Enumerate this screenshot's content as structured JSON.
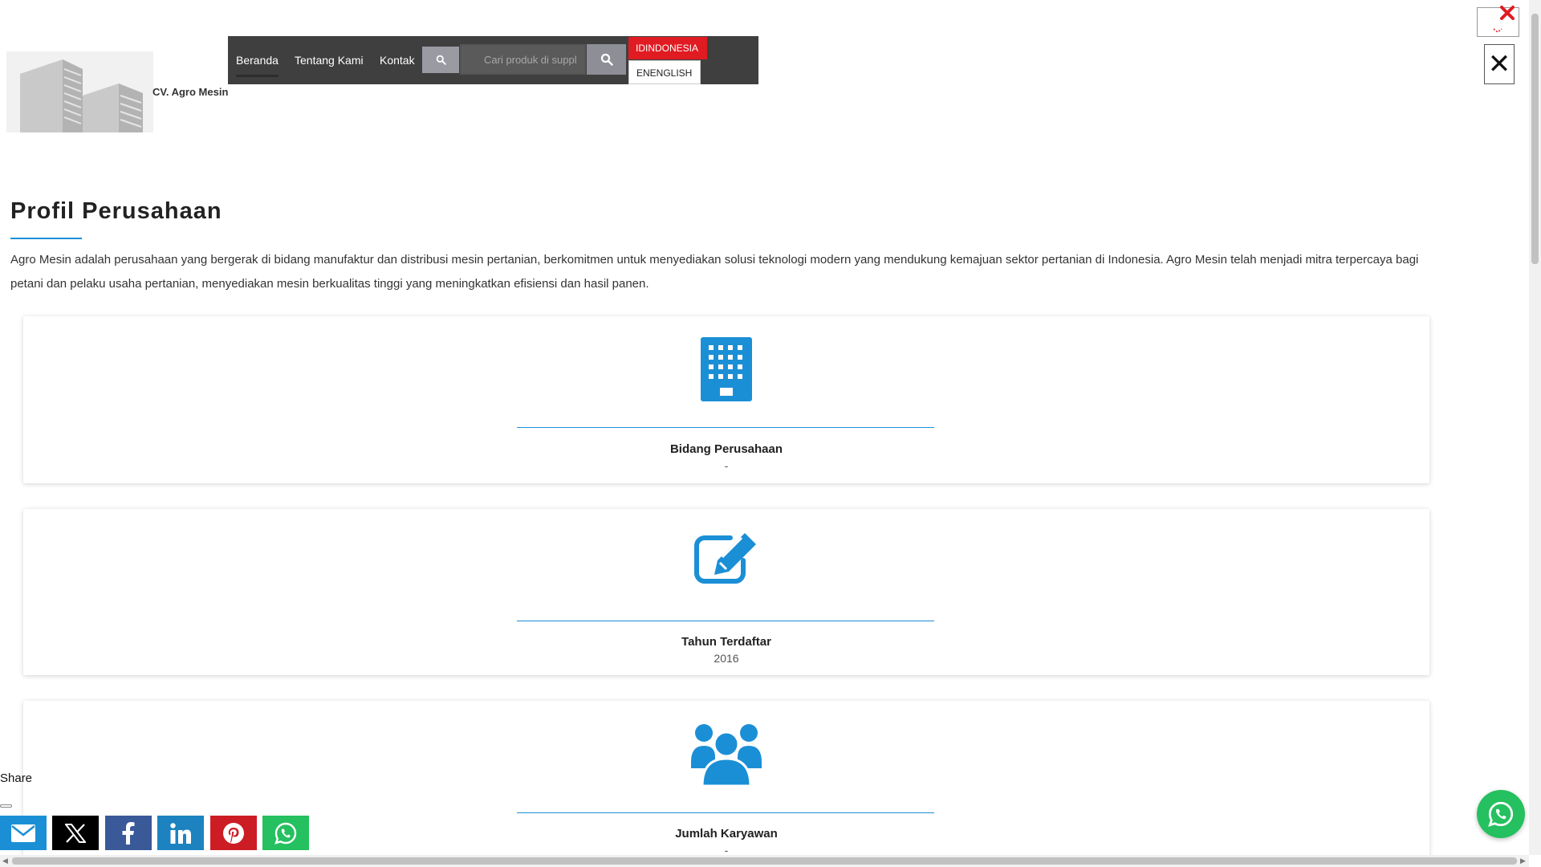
{
  "header": {
    "company_name": "CV. Agro Mesin",
    "nav": [
      {
        "label": "Beranda"
      },
      {
        "label": "Tentang Kami"
      },
      {
        "label": "Kontak"
      }
    ],
    "search": {
      "placeholder": "Cari produk di suppl"
    },
    "languages": [
      {
        "label": "IDINDONESIA"
      },
      {
        "label": "ENENGLISH"
      }
    ]
  },
  "main": {
    "title": "Profil Perusahaan",
    "intro": "Agro Mesin adalah perusahaan yang bergerak di bidang manufaktur dan distribusi mesin pertanian, berkomitmen untuk menyediakan solusi teknologi modern yang mendukung kemajuan sektor pertanian di Indonesia. Agro Mesin telah menjadi mitra terpercaya bagi petani dan pelaku usaha pertanian, menyediakan mesin berkualitas tinggi yang meningkatkan efisiensi dan hasil panen.",
    "cards": [
      {
        "icon": "building-icon",
        "label": "Bidang Perusahaan",
        "value": "-"
      },
      {
        "icon": "edit-icon",
        "label": "Tahun Terdaftar",
        "value": "2016"
      },
      {
        "icon": "users-icon",
        "label": "Jumlah Karyawan",
        "value": "-"
      }
    ]
  },
  "share": {
    "label": "Share",
    "buttons": [
      {
        "icon": "email-icon",
        "color": "#1b8fd6"
      },
      {
        "icon": "x-icon",
        "color": "#000000"
      },
      {
        "icon": "facebook-icon",
        "color": "#3a5998"
      },
      {
        "icon": "linkedin-icon",
        "color": "#1c83c0"
      },
      {
        "icon": "pinterest-icon",
        "color": "#cc1d24"
      },
      {
        "icon": "whatsapp-icon",
        "color": "#25c05f"
      }
    ]
  },
  "colors": {
    "accent": "#1b8fd6",
    "navbar": "#3f3f3f",
    "language_active": "#e01b22",
    "whatsapp": "#25c05f"
  }
}
